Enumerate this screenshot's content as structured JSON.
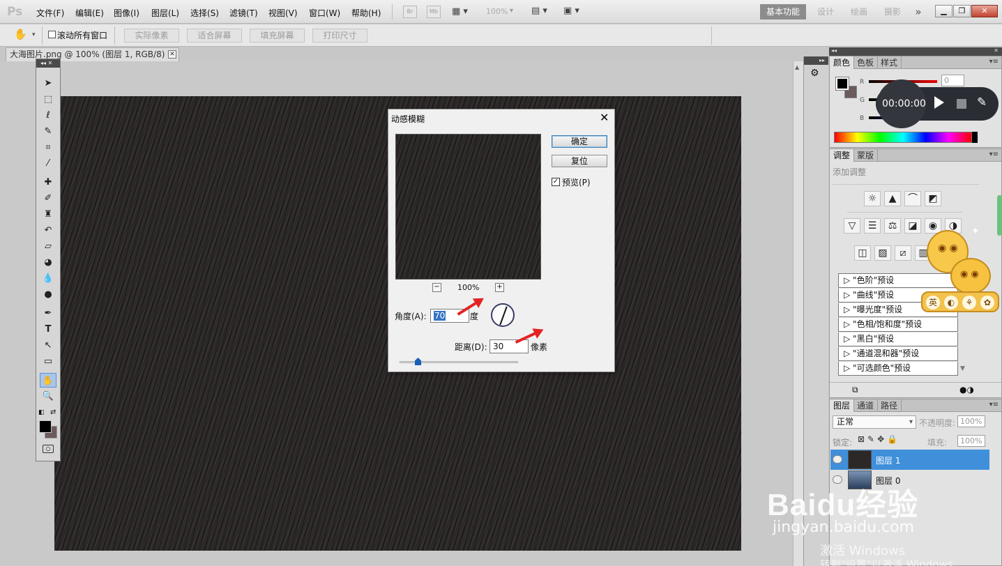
{
  "app": {
    "logo": "Ps",
    "menus": [
      "文件(F)",
      "编辑(E)",
      "图像(I)",
      "图层(L)",
      "选择(S)",
      "滤镜(T)",
      "视图(V)",
      "窗口(W)",
      "帮助(H)"
    ],
    "toolbar_icons": [
      "Br",
      "Mb"
    ],
    "zoom": "100%",
    "workspaces": [
      "基本功能",
      "设计",
      "绘画",
      "摄影"
    ],
    "more": "»"
  },
  "options": {
    "scroll_all_label": "滚动所有窗口",
    "buttons": [
      "实际像素",
      "适合屏幕",
      "填充屏幕",
      "打印尺寸"
    ]
  },
  "document": {
    "tab_title": "大海图片.png @ 100% (图层 1, RGB/8) *"
  },
  "dialog": {
    "title": "动感模糊",
    "ok": "确定",
    "reset": "复位",
    "preview_label": "预览(P)",
    "preview_checked": true,
    "zoom": "100%",
    "zoom_out": "−",
    "zoom_in": "+",
    "angle_label": "角度(A):",
    "angle_value": "70",
    "angle_unit": "度",
    "distance_label": "距离(D):",
    "distance_value": "30",
    "distance_unit": "像素"
  },
  "color_panel": {
    "tabs": [
      "颜色",
      "色板",
      "样式"
    ],
    "r_label": "R",
    "g_label": "G",
    "b_label": "B",
    "r_value": "0"
  },
  "adjust_panel": {
    "tabs": [
      "调整",
      "蒙版"
    ],
    "heading": "添加调整",
    "presets": [
      "\"色阶\"预设",
      "\"曲线\"预设",
      "\"曝光度\"预设",
      "\"色相/饱和度\"预设",
      "\"黑白\"预设",
      "\"通道混和器\"预设",
      "\"可选颜色\"预设"
    ]
  },
  "layers_panel": {
    "tabs": [
      "图层",
      "通道",
      "路径"
    ],
    "blend_mode": "正常",
    "opacity_label": "不透明度:",
    "opacity": "100%",
    "lock_label": "锁定:",
    "fill_label": "填充:",
    "fill": "100%",
    "layers": [
      {
        "name": "图层 1",
        "selected": true
      },
      {
        "name": "图层 0",
        "selected": false
      }
    ]
  },
  "recorder": {
    "time": "00:00:00"
  },
  "sticker": {
    "chips": [
      "英",
      "◐",
      "⚘",
      "✿"
    ]
  },
  "watermark": {
    "logo": "Baidu经验",
    "site": "jingyan.baidu.com",
    "activate_1": "激活 Windows",
    "activate_2": "转到\"设置\"以激活 Windows。"
  },
  "colors": {
    "accent": "#3f8fda",
    "canvas": "#2c2828",
    "arrow": "#e32323"
  }
}
